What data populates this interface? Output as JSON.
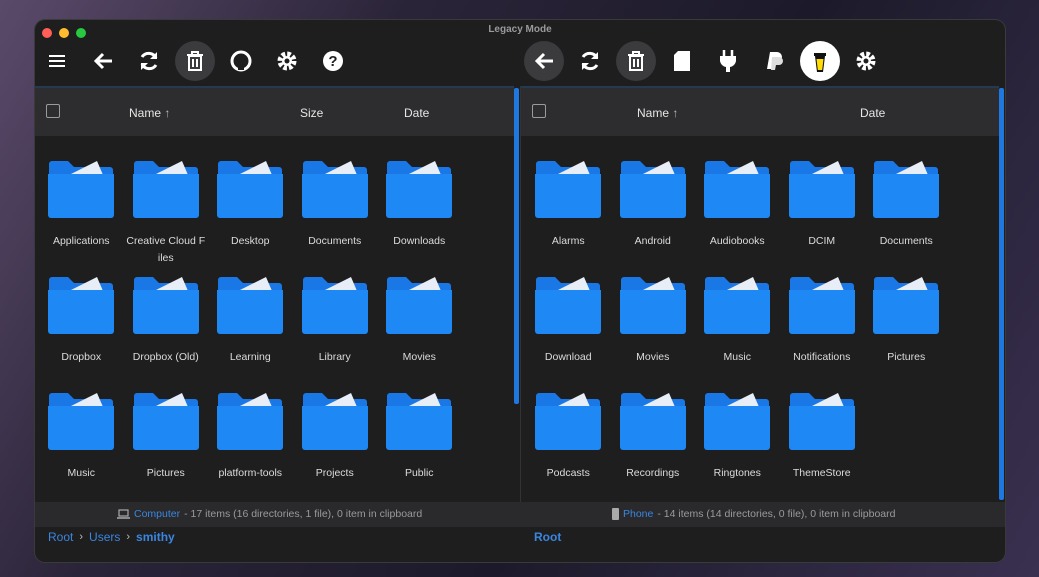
{
  "window": {
    "title": "Legacy Mode"
  },
  "left": {
    "toolbar": [
      "menu-icon",
      "back-icon",
      "refresh-icon",
      "trash-icon",
      "github-icon",
      "gear-icon",
      "help-icon"
    ],
    "header": {
      "name": "Name",
      "sort": "↑",
      "size": "Size",
      "date": "Date"
    },
    "items": [
      "Applications",
      "Creative Cloud Files",
      "Desktop",
      "Documents",
      "Downloads",
      "Dropbox",
      "Dropbox (Old)",
      "Learning",
      "Library",
      "Movies",
      "Music",
      "Pictures",
      "platform-tools",
      "Projects",
      "Public"
    ],
    "status": {
      "device": "Computer",
      "text": "- 17 items (16 directories, 1 file), 0 item in clipboard"
    },
    "breadcrumb": [
      "Root",
      "Users",
      "smithy"
    ]
  },
  "right": {
    "toolbar": [
      "back-icon",
      "refresh-icon",
      "trash-icon",
      "sd-card-icon",
      "plug-icon",
      "paypal-icon",
      "buy-me-coffee-icon",
      "gear-icon"
    ],
    "header": {
      "name": "Name",
      "sort": "↑",
      "date": "Date"
    },
    "items": [
      "Alarms",
      "Android",
      "Audiobooks",
      "DCIM",
      "Documents",
      "Download",
      "Movies",
      "Music",
      "Notifications",
      "Pictures",
      "Podcasts",
      "Recordings",
      "Ringtones",
      "ThemeStore"
    ],
    "status": {
      "device": "Phone",
      "text": "- 14 items (14 directories, 0 file), 0 item in clipboard"
    },
    "breadcrumb": [
      "Root"
    ]
  },
  "colors": {
    "accent": "#1f78e0",
    "folder": "#1e88f5"
  }
}
